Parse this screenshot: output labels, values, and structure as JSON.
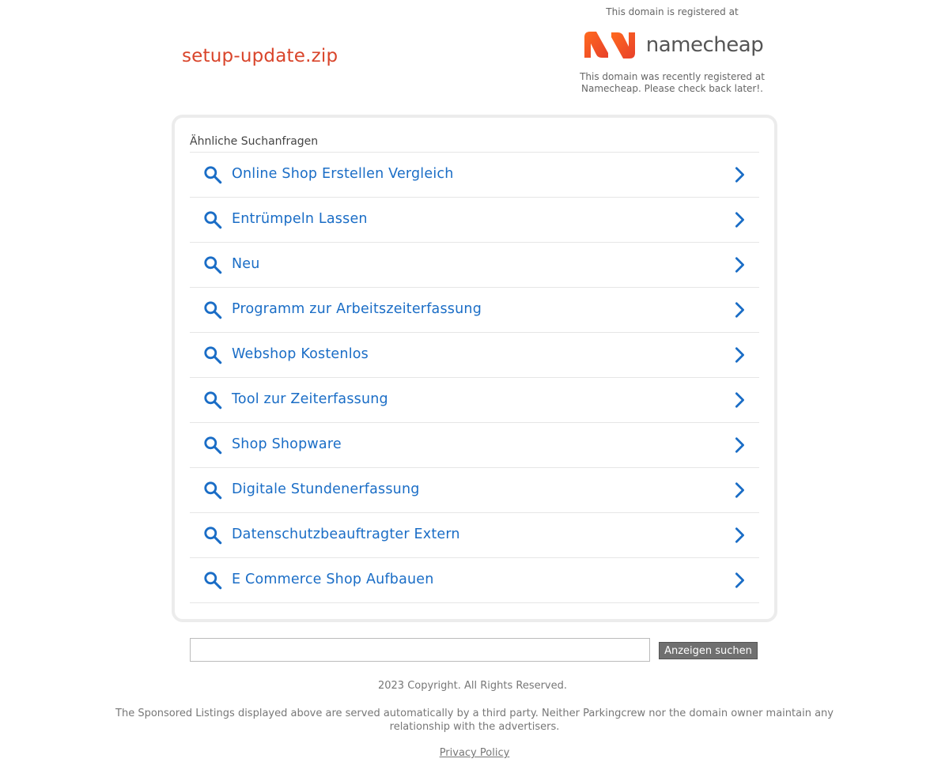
{
  "header": {
    "domain": "setup-update.zip"
  },
  "registrar": {
    "top_text": "This domain is registered at",
    "logo_text": "namecheap",
    "bottom_text": "This domain was recently registered at Namecheap. Please check back later!.",
    "logo_colors": {
      "start": "#ff5c1a",
      "end": "#f0512a"
    }
  },
  "related": {
    "title": "Ähnliche Suchanfragen",
    "items": [
      {
        "label": "Online Shop Erstellen Vergleich"
      },
      {
        "label": "Entrümpeln Lassen"
      },
      {
        "label": "Neu"
      },
      {
        "label": "Programm zur Arbeitszeiterfassung"
      },
      {
        "label": "Webshop Kostenlos"
      },
      {
        "label": "Tool zur Zeiterfassung"
      },
      {
        "label": "Shop Shopware"
      },
      {
        "label": "Digitale Stundenerfassung"
      },
      {
        "label": "Datenschutzbeauftragter Extern"
      },
      {
        "label": "E Commerce Shop Aufbauen"
      }
    ],
    "icons": {
      "left": "search-icon",
      "right": "chevron-right-icon"
    },
    "link_color": "#1a6dc6"
  },
  "search": {
    "value": "",
    "button_label": "Anzeigen suchen"
  },
  "footer": {
    "copyright": "2023 Copyright. All Rights Reserved.",
    "disclaimer": "The Sponsored Listings displayed above are served automatically by a third party. Neither Parkingcrew nor the domain owner maintain any relationship with the advertisers.",
    "privacy": "Privacy Policy"
  }
}
